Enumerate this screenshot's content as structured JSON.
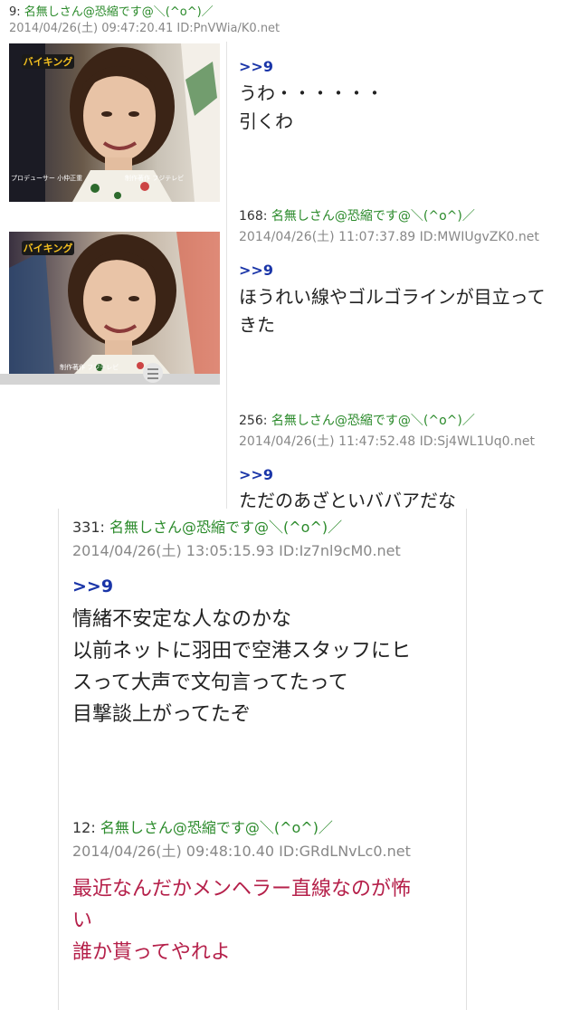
{
  "top_post": {
    "number": "9:",
    "name": "名無しさん@恐縮です@＼(^o^)／",
    "meta": "2014/04/26(土) 09:47:20.41 ID:PnVWia/K0.net"
  },
  "thumb1": {
    "logo": "バイキング",
    "credit": "プロデューサー 小仲正重",
    "broadcaster": "制作著作 フジテレビ"
  },
  "thumb2": {
    "logo": "バイキング",
    "broadcaster": "制作著作 フジテレビ"
  },
  "reply_a": {
    "anchor": ">>9",
    "lines": [
      "うわ・・・・・・",
      "引くわ"
    ]
  },
  "post_168": {
    "number": "168:",
    "name": "名無しさん@恐縮です@＼(^o^)／",
    "meta": "2014/04/26(土) 11:07:37.89 ID:MWIUgvZK0.net",
    "anchor": ">>9",
    "lines": [
      "ほうれい線やゴルゴラインが目立って",
      "きた"
    ]
  },
  "post_256": {
    "number": "256:",
    "name": "名無しさん@恐縮です@＼(^o^)／",
    "meta": "2014/04/26(土) 11:47:52.48 ID:Sj4WL1Uq0.net",
    "anchor": ">>9",
    "lines": [
      "ただのあざといババアだな"
    ]
  },
  "post_331": {
    "number": "331:",
    "name": "名無しさん@恐縮です@＼(^o^)／",
    "meta": "2014/04/26(土) 13:05:15.93 ID:Iz7nl9cM0.net",
    "anchor": ">>9",
    "lines": [
      "情緒不安定な人なのかな",
      "以前ネットに羽田で空港スタッフにヒ",
      "スって大声で文句言ってたって",
      "目撃談上がってたぞ"
    ]
  },
  "post_12": {
    "number": "12:",
    "name": "名無しさん@恐縮です@＼(^o^)／",
    "meta": "2014/04/26(土) 09:48:10.40 ID:GRdLNvLc0.net",
    "lines": [
      "最近なんだかメンヘラー直線なのが怖",
      "い",
      "誰か貰ってやれよ"
    ]
  },
  "colors": {
    "name_green": "#2a8a2a",
    "meta_gray": "#888888",
    "anchor_blue": "#1a35a8",
    "highlight_red": "#b5204a"
  }
}
